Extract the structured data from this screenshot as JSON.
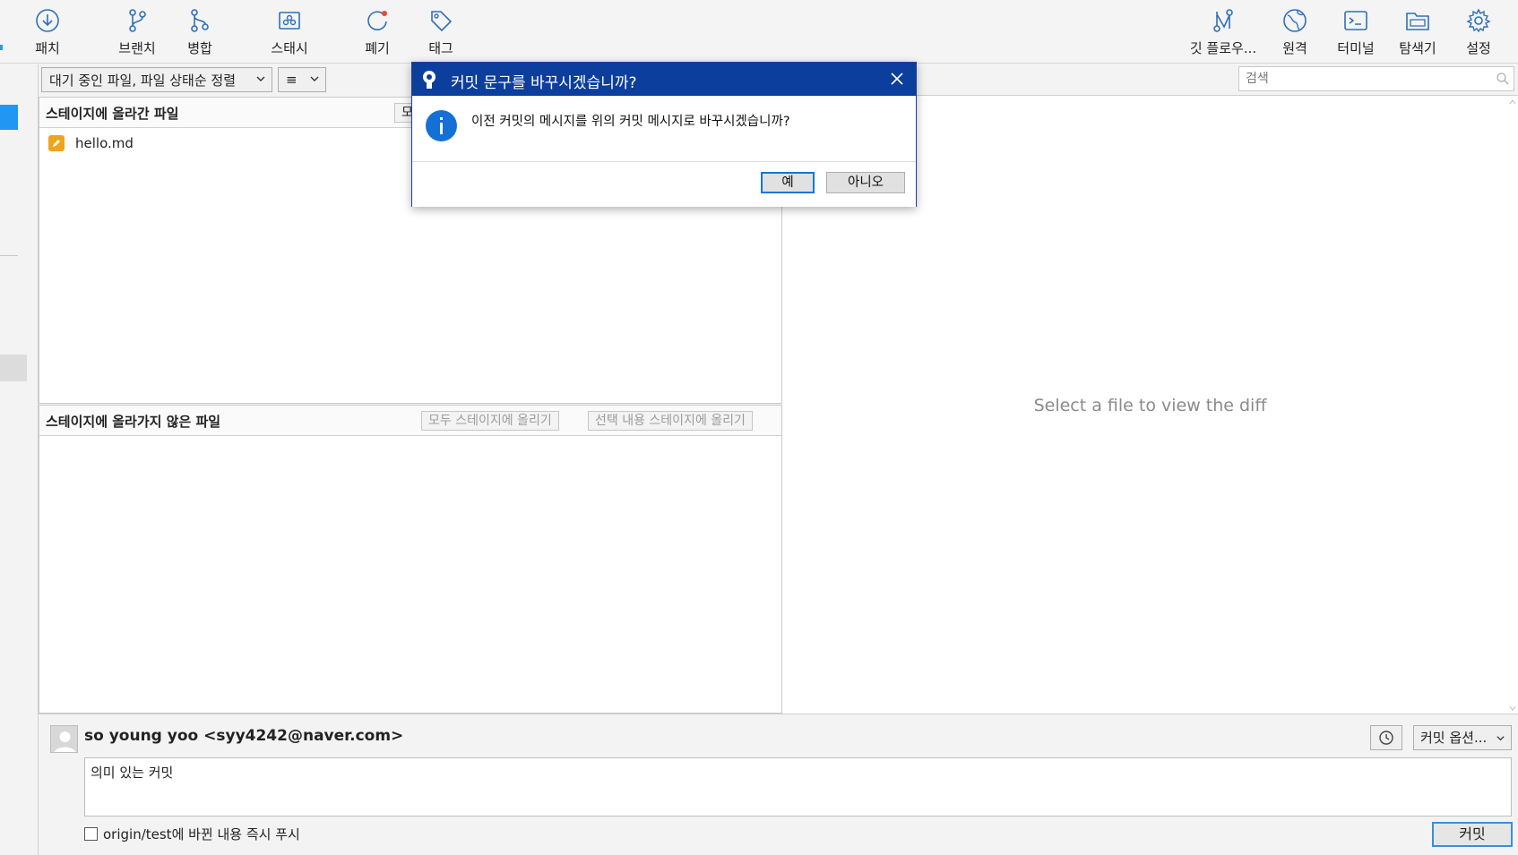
{
  "toolbar": {
    "left": [
      {
        "label": "패치",
        "icon": "fetch-icon"
      },
      {
        "label": "브랜치",
        "icon": "branch-icon"
      },
      {
        "label": "병합",
        "icon": "merge-icon"
      },
      {
        "label": "스태시",
        "icon": "stash-icon"
      },
      {
        "label": "폐기",
        "icon": "discard-icon"
      },
      {
        "label": "태그",
        "icon": "tag-icon"
      }
    ],
    "right": [
      {
        "label": "깃 플로우...",
        "icon": "git-flow-icon"
      },
      {
        "label": "원격",
        "icon": "remote-globe-icon"
      },
      {
        "label": "터미널",
        "icon": "terminal-icon"
      },
      {
        "label": "탐색기",
        "icon": "explorer-icon"
      },
      {
        "label": "설정",
        "icon": "gear-icon"
      }
    ]
  },
  "filter": {
    "sort_label": "대기 중인 파일, 파일 상태순 정렬",
    "view_label": "≡"
  },
  "search": {
    "placeholder": "검색"
  },
  "staged": {
    "title": "스테이지에 올라간 파일",
    "partial_button": "모",
    "files": [
      {
        "name": "hello.md",
        "status": "modified"
      }
    ]
  },
  "unstaged": {
    "title": "스테이지에 올라가지 않은 파일",
    "stage_all": "모두 스테이지에 올리기",
    "stage_selected": "선택 내용 스테이지에 올리기"
  },
  "diff": {
    "empty_message": "Select a file to view the diff"
  },
  "commit": {
    "author": "so young yoo <syy4242@naver.com>",
    "message": "의미 있는 커밋",
    "options_label": "커밋 옵션...",
    "push_label": "origin/test에 바뀐 내용 즉시 푸시",
    "push_checked": false,
    "commit_button": "커밋"
  },
  "dialog": {
    "title": "커밋 문구를 바꾸시겠습니까?",
    "message": "이전 커밋의 메시지를 위의 커밋 메시지로 바꾸시겠습니까?",
    "yes": "예",
    "no": "아니오"
  },
  "colors": {
    "dialog_title_bar": "#0c3e9e",
    "accent_blue": "#2196f3",
    "modified_file": "#f0a41c"
  }
}
